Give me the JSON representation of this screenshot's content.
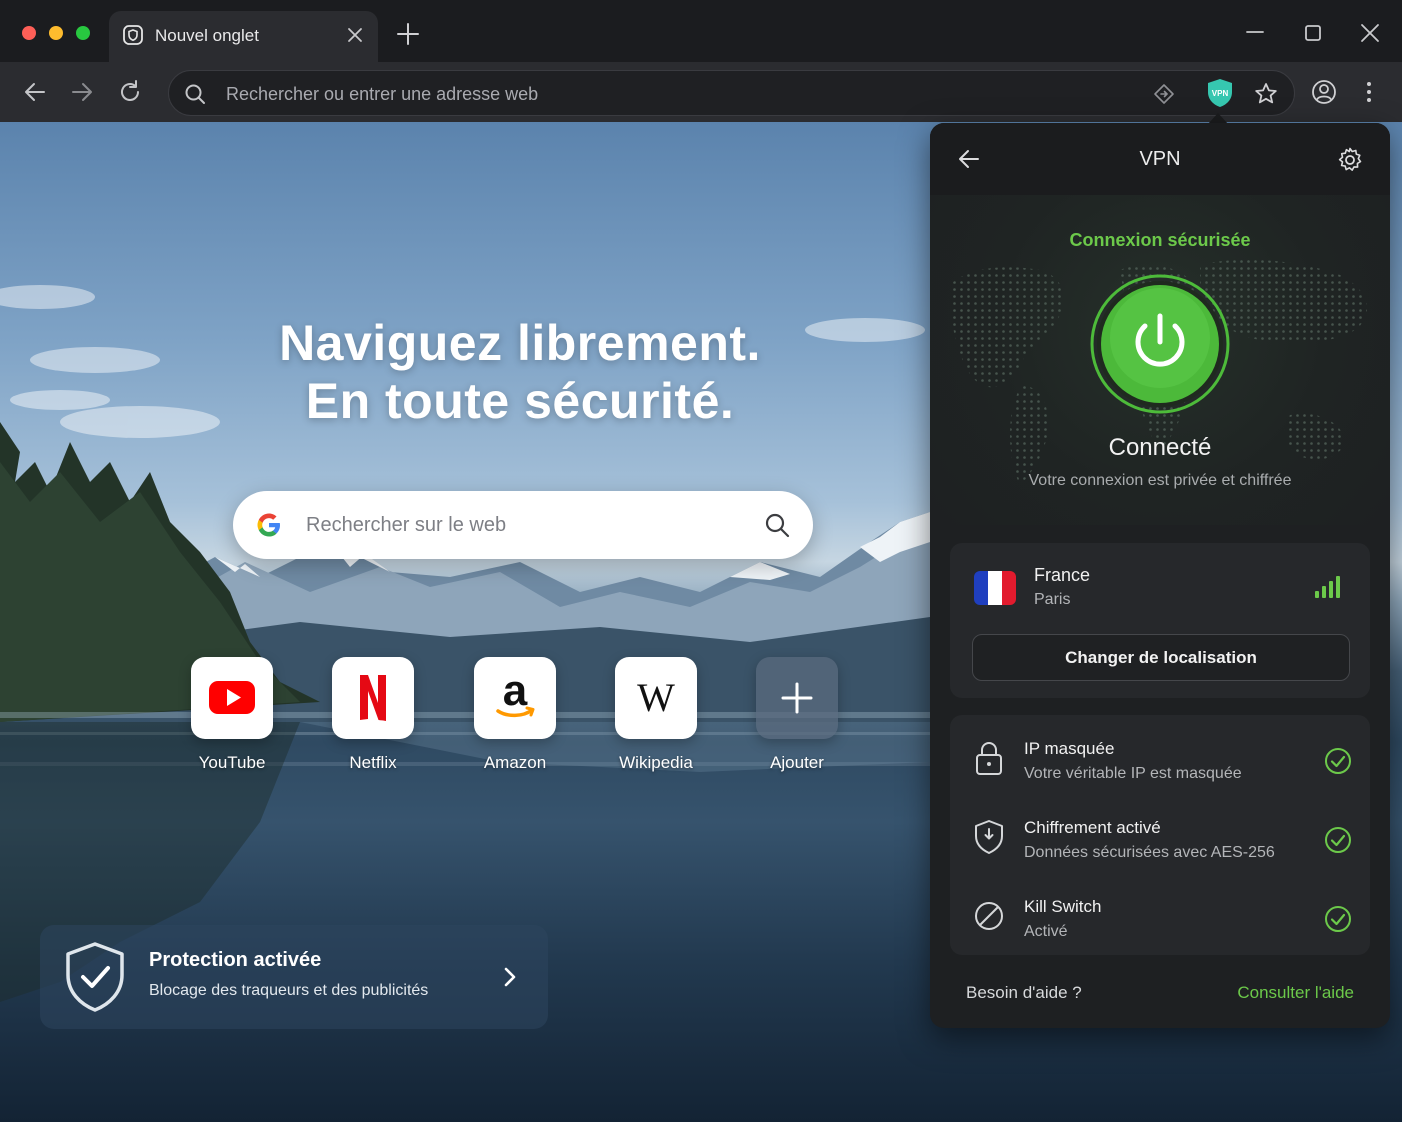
{
  "browser": {
    "tab_title": "Nouvel onglet",
    "address_placeholder": "Rechercher ou entrer une adresse web",
    "vpn_badge_text": "VPN"
  },
  "newtab": {
    "headline_line1": "Naviguez librement.",
    "headline_line2": "En toute sécurité.",
    "search_placeholder": "Rechercher sur le web",
    "shortcuts": [
      {
        "label": "YouTube",
        "icon": "youtube-icon"
      },
      {
        "label": "Netflix",
        "icon": "netflix-icon"
      },
      {
        "label": "Amazon",
        "icon": "amazon-icon"
      },
      {
        "label": "Wikipedia",
        "icon": "wikipedia-icon"
      },
      {
        "label": "Ajouter",
        "icon": "plus-icon"
      }
    ],
    "protection": {
      "title": "Protection activée",
      "subtitle": "Blocage des traqueurs et des publicités"
    }
  },
  "vpn": {
    "title": "VPN",
    "status_headline": "Connexion sécurisée",
    "state": "Connecté",
    "state_detail": "Votre connexion est privée et chiffrée",
    "location": {
      "country": "France",
      "city": "Paris",
      "change_button": "Changer de localisation"
    },
    "features": [
      {
        "title": "IP masquée",
        "subtitle": "Votre véritable IP est masquée",
        "icon": "lock-icon"
      },
      {
        "title": "Chiffrement activé",
        "subtitle": "Données sécurisées avec AES-256",
        "icon": "shield-icon"
      },
      {
        "title": "Kill Switch",
        "subtitle": "Activé",
        "icon": "block-icon"
      }
    ],
    "help_question": "Besoin d'aide ?",
    "help_link": "Consulter l'aide"
  },
  "colors": {
    "accent_green": "#6cc94a",
    "panel_bg": "#1e2022",
    "youtube_red": "#ff0000",
    "netflix_red": "#e50914"
  }
}
